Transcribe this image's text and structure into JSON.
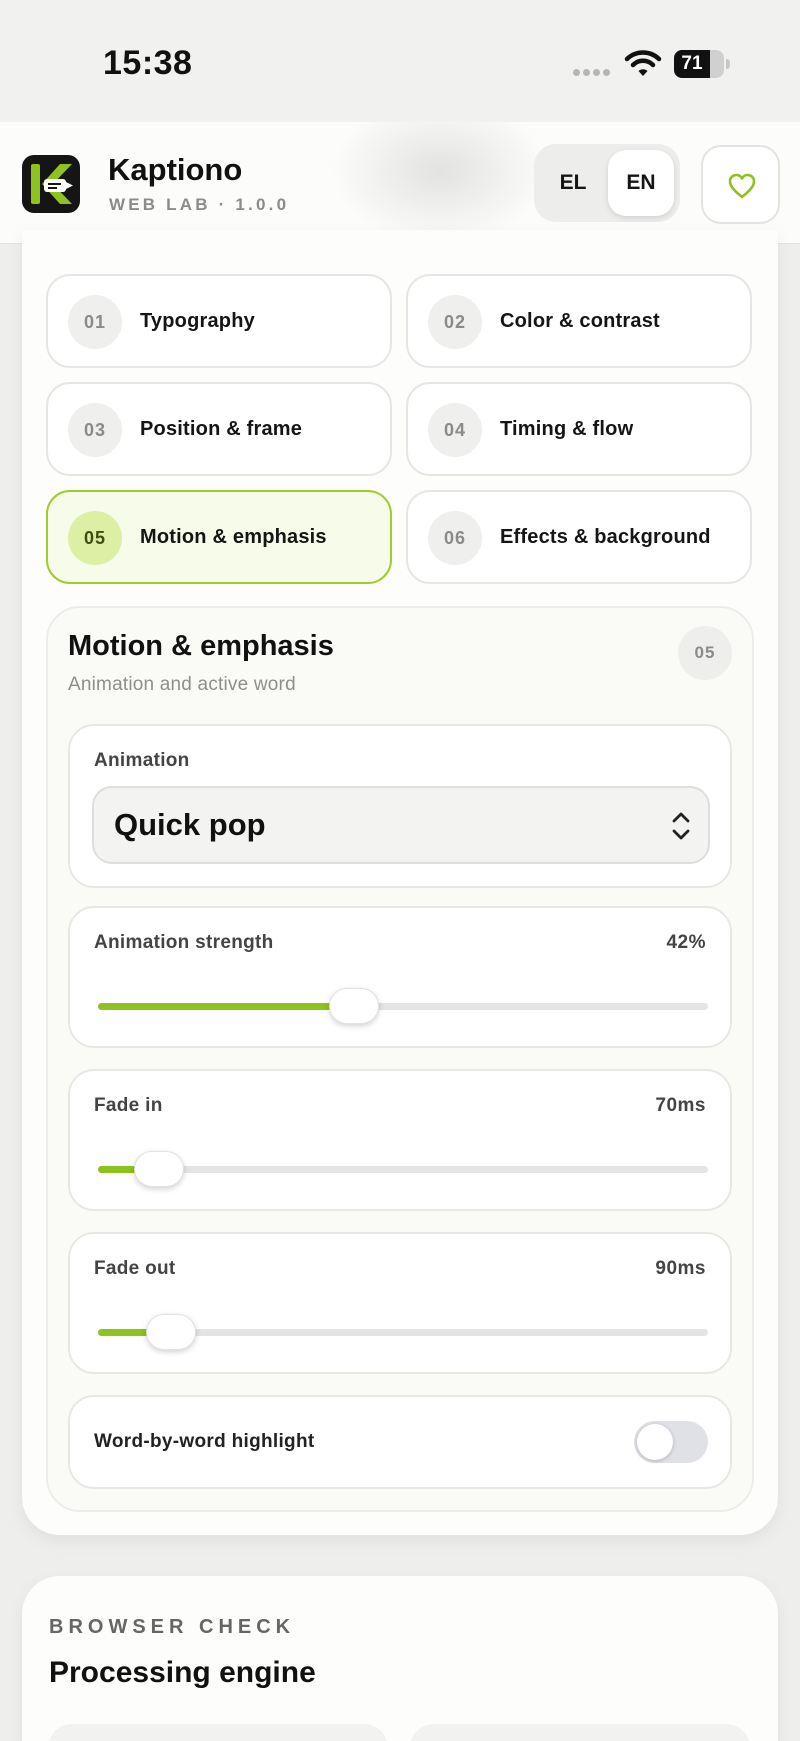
{
  "status_bar": {
    "time": "15:38",
    "battery_level": "71",
    "icons": [
      "signal-dots-icon",
      "wifi-icon",
      "battery-icon"
    ]
  },
  "header": {
    "app_name": "Kaptiono",
    "app_version": "WEB LAB · 1.0.0",
    "languages": [
      "EL",
      "EN"
    ],
    "active_language": "EN",
    "favorite_icon": "heart-icon",
    "accent_color": "#8dc21f"
  },
  "sections": [
    {
      "num": "01",
      "label": "Typography"
    },
    {
      "num": "02",
      "label": "Color & contrast"
    },
    {
      "num": "03",
      "label": "Position & frame"
    },
    {
      "num": "04",
      "label": "Timing & flow"
    },
    {
      "num": "05",
      "label": "Motion & emphasis"
    },
    {
      "num": "06",
      "label": "Effects & background"
    }
  ],
  "active_section": "05",
  "panel": {
    "title": "Motion & emphasis",
    "subtitle": "Animation and active word",
    "badge": "05",
    "animation": {
      "label": "Animation",
      "selected": "Quick pop",
      "icon": "chevron-up-down-icon"
    },
    "sliders": [
      {
        "label": "Animation strength",
        "value_text": "42%",
        "fraction": 0.42
      },
      {
        "label": "Fade in",
        "value_text": "70ms",
        "fraction": 0.1
      },
      {
        "label": "Fade out",
        "value_text": "90ms",
        "fraction": 0.12
      }
    ],
    "toggle": {
      "label": "Word-by-word highlight",
      "on": false
    }
  },
  "browser_check": {
    "eyebrow": "BROWSER CHECK",
    "title": "Processing engine"
  }
}
